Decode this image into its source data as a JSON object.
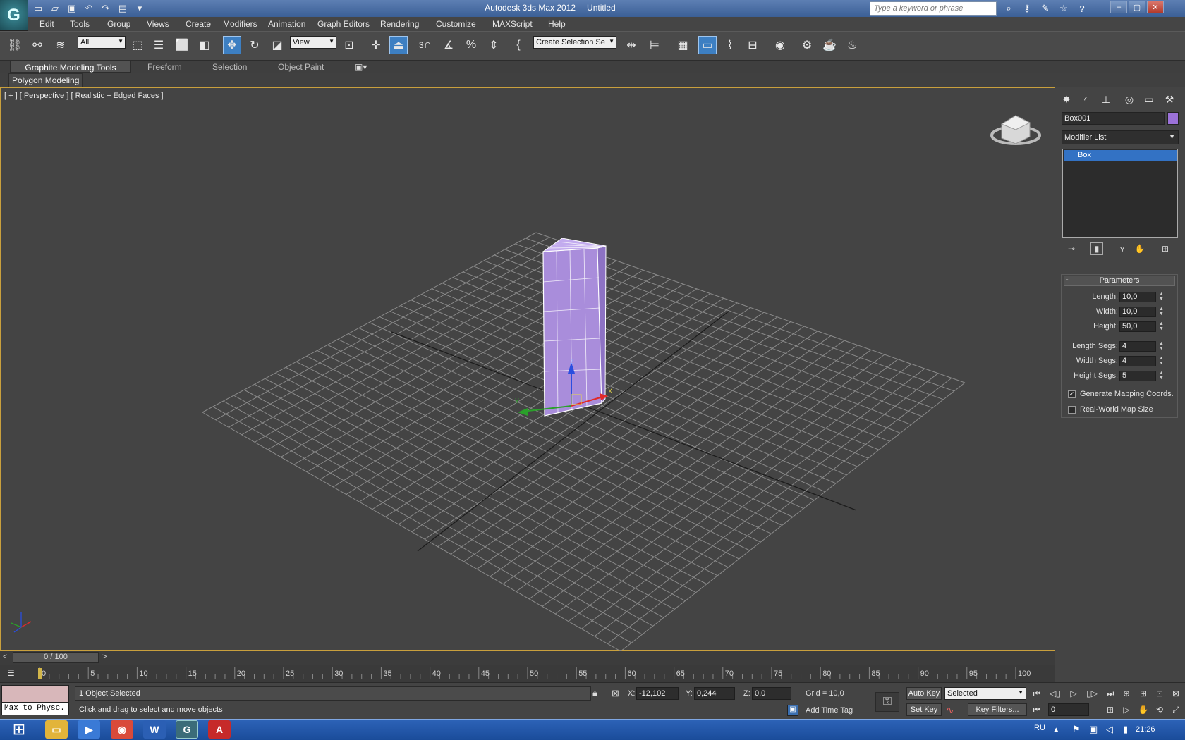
{
  "title": {
    "app": "Autodesk 3ds Max  2012",
    "document": "Untitled",
    "search_placeholder": "Type a keyword or phrase"
  },
  "menu": [
    "Edit",
    "Tools",
    "Group",
    "Views",
    "Create",
    "Modifiers",
    "Animation",
    "Graph Editors",
    "Rendering",
    "Customize",
    "MAXScript",
    "Help"
  ],
  "toolbar": {
    "selection_filter": "All",
    "reference_coord": "View",
    "named_selection": "Create Selection Se",
    "snap_label": "3"
  },
  "ribbon": {
    "tabs": [
      "Graphite Modeling Tools",
      "Freeform",
      "Selection",
      "Object Paint"
    ],
    "panel": "Polygon Modeling"
  },
  "viewport": {
    "label": "[ + ] [ Perspective ] [ Realistic + Edged Faces ]",
    "object_color": "#a98ddb",
    "viewcube_icon": "viewcube-icon",
    "gizmo_axes": [
      "X",
      "Y",
      "Z"
    ]
  },
  "command_panel": {
    "object_name": "Box001",
    "object_color": "#9b71d8",
    "modifier_list": "Modifier List",
    "stack_item": "Box",
    "rollout_title": "Parameters",
    "params": [
      {
        "label": "Length:",
        "value": "10,0"
      },
      {
        "label": "Width:",
        "value": "10,0"
      },
      {
        "label": "Height:",
        "value": "50,0"
      },
      {
        "label": "Length Segs:",
        "value": "4"
      },
      {
        "label": "Width Segs:",
        "value": "4"
      },
      {
        "label": "Height Segs:",
        "value": "5"
      }
    ],
    "checkboxes": [
      {
        "label": "Generate Mapping Coords.",
        "checked": true
      },
      {
        "label": "Real-World Map Size",
        "checked": false
      }
    ]
  },
  "timeline": {
    "frame_display": "0 / 100",
    "ticks": [
      "0",
      "5",
      "10",
      "15",
      "20",
      "25",
      "30",
      "35",
      "40",
      "45",
      "50",
      "55",
      "60",
      "65",
      "70",
      "75",
      "80",
      "85",
      "90",
      "95",
      "100"
    ]
  },
  "status": {
    "maxscript": "Max to Physc.",
    "selection": "1 Object Selected",
    "prompt": "Click and drag to select and move objects",
    "x_label": "X:",
    "x_value": "-12,102",
    "y_label": "Y:",
    "y_value": "0,244",
    "z_label": "Z:",
    "z_value": "0,0",
    "grid": "Grid = 10,0",
    "add_time_tag": "Add Time Tag",
    "auto_key": "Auto Key",
    "set_key": "Set Key",
    "key_mode": "Selected",
    "key_filters": "Key Filters...",
    "frame": "0"
  },
  "taskbar": {
    "lang": "RU",
    "clock": "21:26",
    "apps": [
      "explorer-icon",
      "media-player-icon",
      "chrome-icon",
      "word-icon",
      "3dsmax-icon",
      "acrobat-icon"
    ]
  }
}
